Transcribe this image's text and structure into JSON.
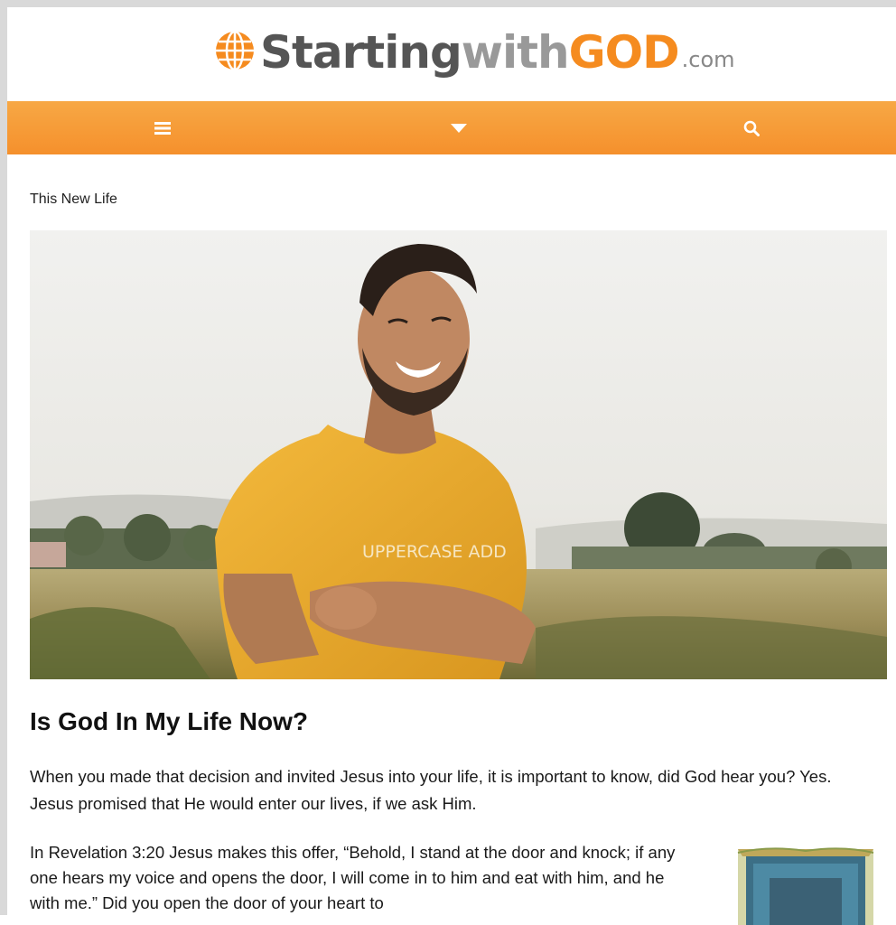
{
  "site": {
    "logo": {
      "part1": "Starting",
      "part2": "with",
      "part3": "GOD",
      "part4": ".com"
    }
  },
  "nav": {
    "menu_icon": "hamburger-menu-icon",
    "dropdown_icon": "caret-down-icon",
    "search_icon": "search-icon"
  },
  "breadcrumb": "This New Life",
  "hero": {
    "shirt_text": "UPPERCASE ADD",
    "icon": "photo-smiling-man-in-field"
  },
  "article": {
    "title": "Is God In My Life Now?",
    "paragraphs": [
      "When you made that decision and invited Jesus into your life, it is important to know, did God hear you? Yes. Jesus promised that He would enter our lives, if we ask Him.",
      "In Revelation 3:20 Jesus makes this offer, “Behold, I stand at the door and knock; if any one hears my voice and opens the door, I will come in to him and eat with him, and he with me.” Did you open the door of your heart to"
    ]
  },
  "colors": {
    "brand_orange": "#f58b1f",
    "nav_gradient_top": "#f7a845",
    "nav_gradient_bottom": "#f5902c",
    "logo_dark": "#555555",
    "logo_light": "#999999"
  }
}
